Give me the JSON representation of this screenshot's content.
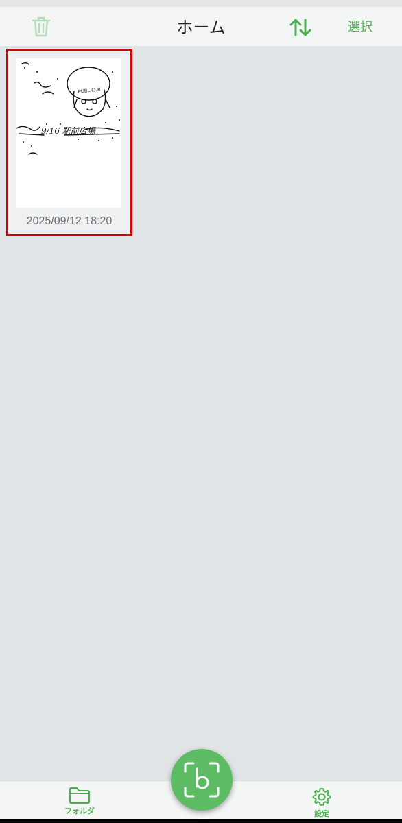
{
  "header": {
    "title": "ホーム",
    "select_label": "選択"
  },
  "icons": {
    "trash": "trash-icon",
    "sort": "sort-arrows-icon",
    "folder": "folder-icon",
    "settings": "gear-icon",
    "scan": "scan-camera-icon"
  },
  "colors": {
    "accent": "#4cae4f",
    "selection_border": "#e00000",
    "background": "#e1e4e6"
  },
  "documents": [
    {
      "date": "2025/09/12 18:20",
      "thumbnail_text": "9/16 駅前広場",
      "thumbnail_sticker_text": "PUBLIC AI",
      "selected": true
    }
  ],
  "bottom_nav": {
    "folder_label": "フォルダ",
    "settings_label": "設定"
  }
}
